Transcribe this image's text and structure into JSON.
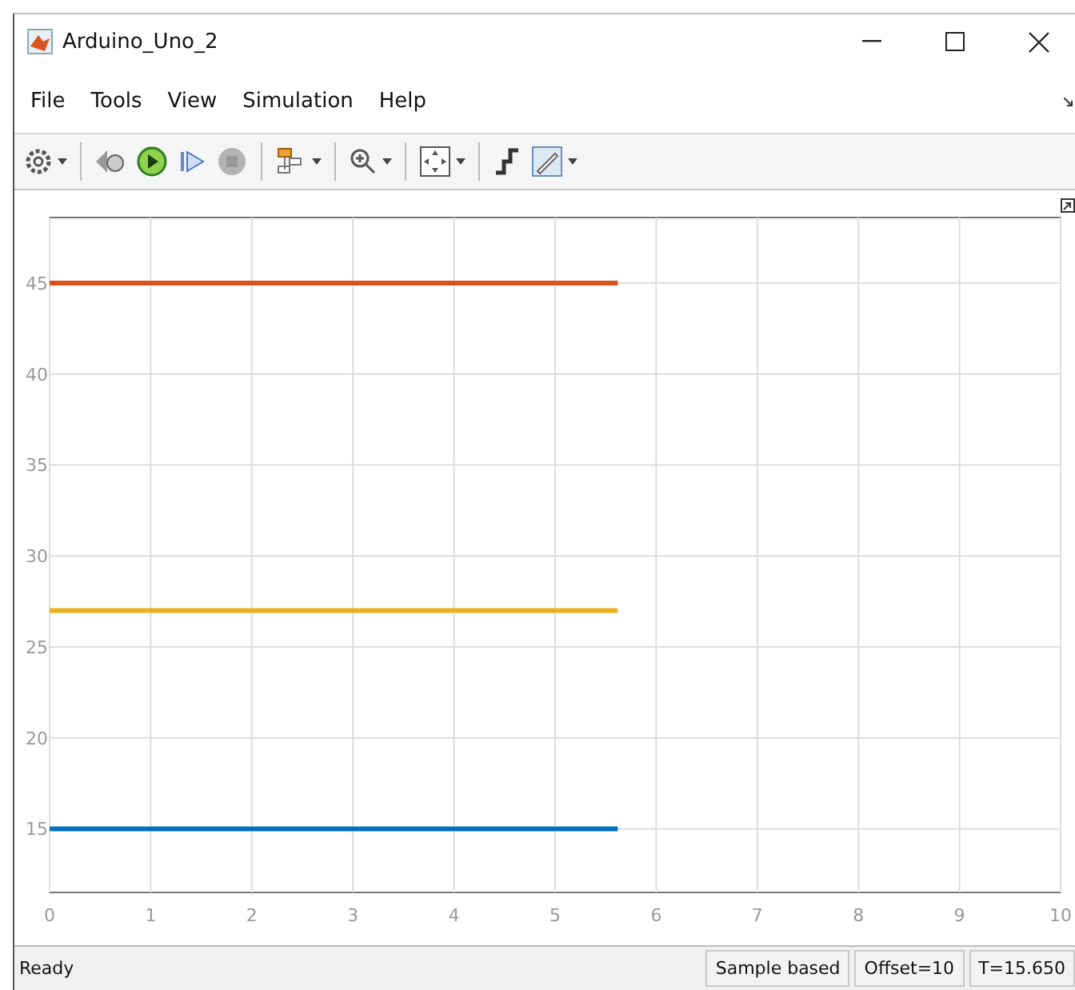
{
  "window": {
    "title": "Arduino_Uno_2"
  },
  "menu": [
    "File",
    "Tools",
    "View",
    "Simulation",
    "Help"
  ],
  "toolbar": [
    {
      "kind": "gear",
      "dropdown": true
    },
    {
      "kind": "step-back",
      "dropdown": false
    },
    {
      "kind": "run",
      "dropdown": false
    },
    {
      "kind": "step-forward",
      "dropdown": false
    },
    {
      "kind": "stop",
      "dropdown": false,
      "disabled": true
    },
    {
      "kind": "blocks",
      "dropdown": true
    },
    {
      "kind": "zoom",
      "dropdown": true
    },
    {
      "kind": "fit",
      "dropdown": true
    },
    {
      "kind": "signal",
      "dropdown": false
    },
    {
      "kind": "style",
      "dropdown": true
    }
  ],
  "plot": {
    "chart_data": {
      "type": "line",
      "x": [
        0,
        5.62
      ],
      "xlim": [
        0,
        10
      ],
      "ylim": [
        11.5,
        48.6
      ],
      "xticks": [
        0,
        1,
        2,
        3,
        4,
        5,
        6,
        7,
        8,
        9,
        10
      ],
      "yticks": [
        15,
        20,
        25,
        30,
        35,
        40,
        45
      ],
      "grid": true,
      "series": [
        {
          "color": "#d95319",
          "values": [
            45,
            45
          ]
        },
        {
          "color": "#edb120",
          "values": [
            27,
            27
          ]
        },
        {
          "color": "#0072bd",
          "values": [
            15,
            15
          ]
        }
      ]
    }
  },
  "status_bar": {
    "status": "Ready",
    "fields": [
      "Sample based",
      "Offset=10",
      "T=15.650"
    ]
  }
}
